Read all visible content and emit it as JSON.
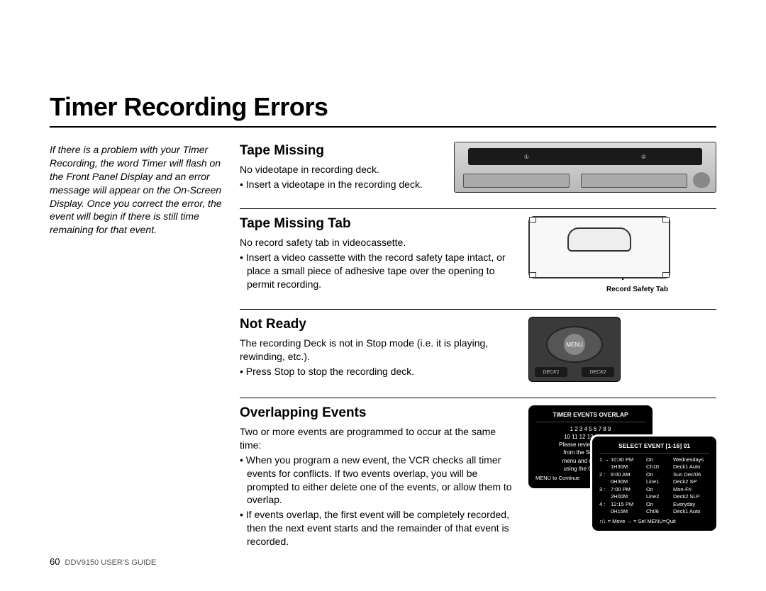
{
  "page": {
    "title": "Timer Recording Errors",
    "intro": "If there is a problem with your Timer Recording, the word Timer will flash on the Front Panel Display and an error message will appear on the On-Screen Display. Once you correct the error, the event will begin if there is still time remaining for that event.",
    "footer_page": "60",
    "footer_text": "DDV9150 USER'S GUIDE"
  },
  "tape_missing": {
    "title": "Tape Missing",
    "line": "No videotape in recording deck.",
    "bullet": "Insert a videotape in the recording deck.",
    "panel_d1": "① ",
    "panel_d2": "②"
  },
  "tape_tab": {
    "title": "Tape Missing Tab",
    "line": "No record safety tab in videocassette.",
    "bullet": "Insert a video cassette with the record safety tape intact, or place a small piece of adhesive tape over the opening to permit recording.",
    "caption": "Record Safety Tab"
  },
  "not_ready": {
    "title": "Not Ready",
    "line": "The recording Deck is not in Stop mode (i.e. it is playing, rewinding, etc.).",
    "bullet": "Press Stop to stop the recording deck.",
    "menu_btn": "MENU",
    "deck1": "DECK1",
    "deck2": "DECK2"
  },
  "overlap": {
    "title": "Overlapping Events",
    "line": "Two or more events are programmed to occur at the same time:",
    "b1": "When you program a new event, the VCR checks all timer events for conflicts. If two events overlap, you will be prompted to either delete one of the events, or allow them to overlap.",
    "b2": "If events overlap, the first event will be completely recorded, then the next event starts and the remainder of that event is recorded.",
    "osd1": {
      "title": "TIMER EVENTS OVERLAP",
      "row1": "1   2   3   4   5   6   7   8   9",
      "row2": "10  11  12  13  14  15  16",
      "msg1": "Please review the events",
      "msg2": "from the Select Event",
      "msg3": "menu and remove one",
      "msg4": "using the CLEAR key",
      "foot": "MENU   to   Continue"
    },
    "osd2": {
      "title": "SELECT EVENT [1-16] 01",
      "rows": [
        {
          "n": "1 →",
          "t": "10:30 PM",
          "c": "On",
          "d": "Wednesdays"
        },
        {
          "n": "",
          "t": "1H30M",
          "c": "Ch10",
          "d": "Deck1 Auto"
        },
        {
          "n": "2 :",
          "t": "9:00 AM",
          "c": "On",
          "d": "Sun Dec/06"
        },
        {
          "n": "",
          "t": "0H30M",
          "c": "Line1",
          "d": "Deck2 SP"
        },
        {
          "n": "3 :",
          "t": "7:00 PM",
          "c": "On",
          "d": "Mon-Fri"
        },
        {
          "n": "",
          "t": "2H00M",
          "c": "Line2",
          "d": "Deck2 SLP"
        },
        {
          "n": "4 :",
          "t": "12:15 PM",
          "c": "On",
          "d": "Everyday"
        },
        {
          "n": "",
          "t": "0H15M",
          "c": "Ch06",
          "d": "Deck1 Auto"
        }
      ],
      "foot": "↑/↓ = Move    → = Sel    MENU=Quit"
    }
  }
}
